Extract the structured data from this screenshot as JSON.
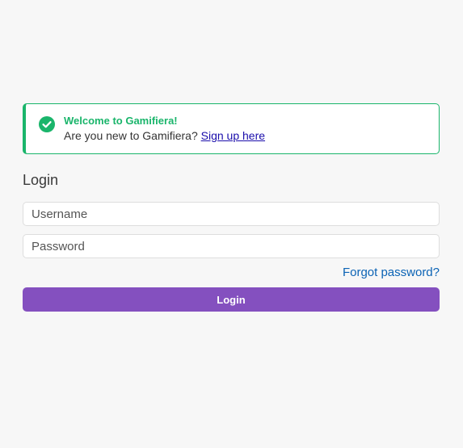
{
  "alert": {
    "icon": "check-circle-icon",
    "title": "Welcome to Gamifiera!",
    "text": "Are you new to Gamifiera?",
    "link_label": "Sign up here",
    "color": "#1ab56b"
  },
  "login": {
    "heading": "Login",
    "username_placeholder": "Username",
    "password_placeholder": "Password",
    "forgot_label": "Forgot password?",
    "button_label": "Login",
    "button_color": "#8450bf"
  }
}
